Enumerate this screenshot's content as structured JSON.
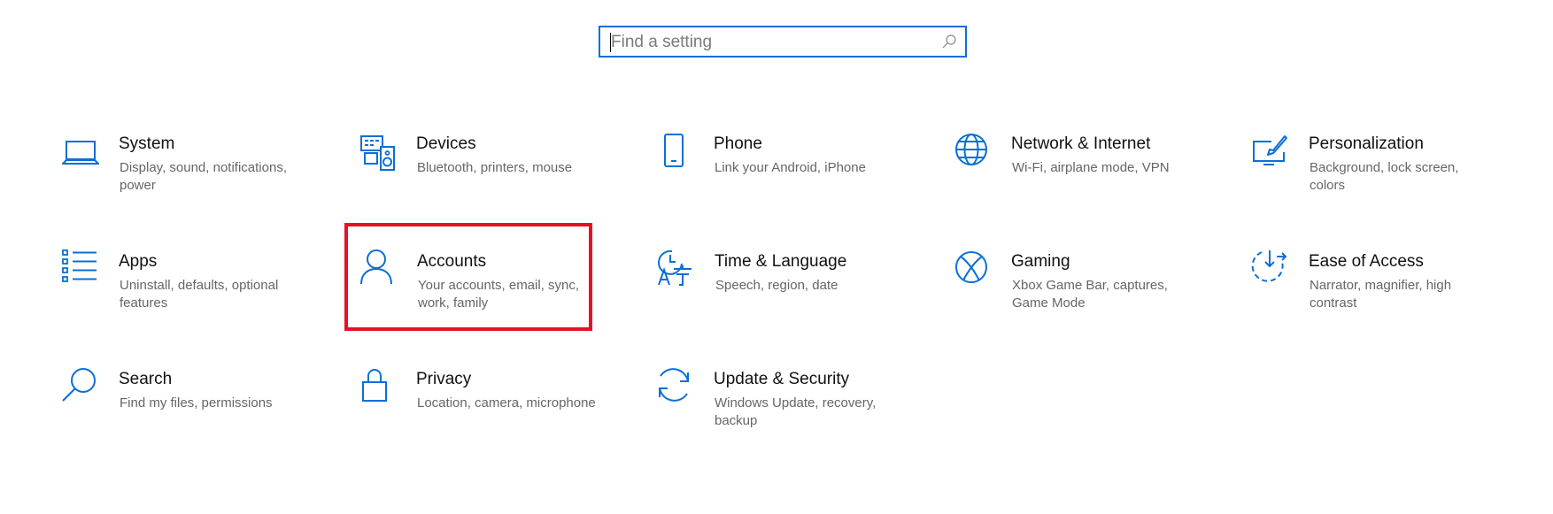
{
  "search": {
    "placeholder": "Find a setting",
    "value": ""
  },
  "categories": [
    {
      "title": "System",
      "desc": "Display, sound, notifications, power",
      "icon": "laptop-icon"
    },
    {
      "title": "Devices",
      "desc": "Bluetooth, printers, mouse",
      "icon": "devices-icon"
    },
    {
      "title": "Phone",
      "desc": "Link your Android, iPhone",
      "icon": "phone-icon"
    },
    {
      "title": "Network & Internet",
      "desc": "Wi-Fi, airplane mode, VPN",
      "icon": "globe-icon"
    },
    {
      "title": "Personalization",
      "desc": "Background, lock screen, colors",
      "icon": "personalization-icon"
    },
    {
      "title": "Apps",
      "desc": "Uninstall, defaults, optional features",
      "icon": "apps-list-icon"
    },
    {
      "title": "Accounts",
      "desc": "Your accounts, email, sync, work, family",
      "icon": "person-icon"
    },
    {
      "title": "Time & Language",
      "desc": "Speech, region, date",
      "icon": "time-language-icon"
    },
    {
      "title": "Gaming",
      "desc": "Xbox Game Bar, captures, Game Mode",
      "icon": "xbox-icon"
    },
    {
      "title": "Ease of Access",
      "desc": "Narrator, magnifier, high contrast",
      "icon": "ease-of-access-icon"
    },
    {
      "title": "Search",
      "desc": "Find my files, permissions",
      "icon": "search-magnifier-icon"
    },
    {
      "title": "Privacy",
      "desc": "Location, camera, microphone",
      "icon": "lock-icon"
    },
    {
      "title": "Update & Security",
      "desc": "Windows Update, recovery, backup",
      "icon": "sync-arrows-icon"
    }
  ],
  "highlighted_category": "Accounts",
  "colors": {
    "accent": "#0a6fd6",
    "highlight_border": "#e81123",
    "title_text": "#111111",
    "desc_text": "#666666"
  }
}
